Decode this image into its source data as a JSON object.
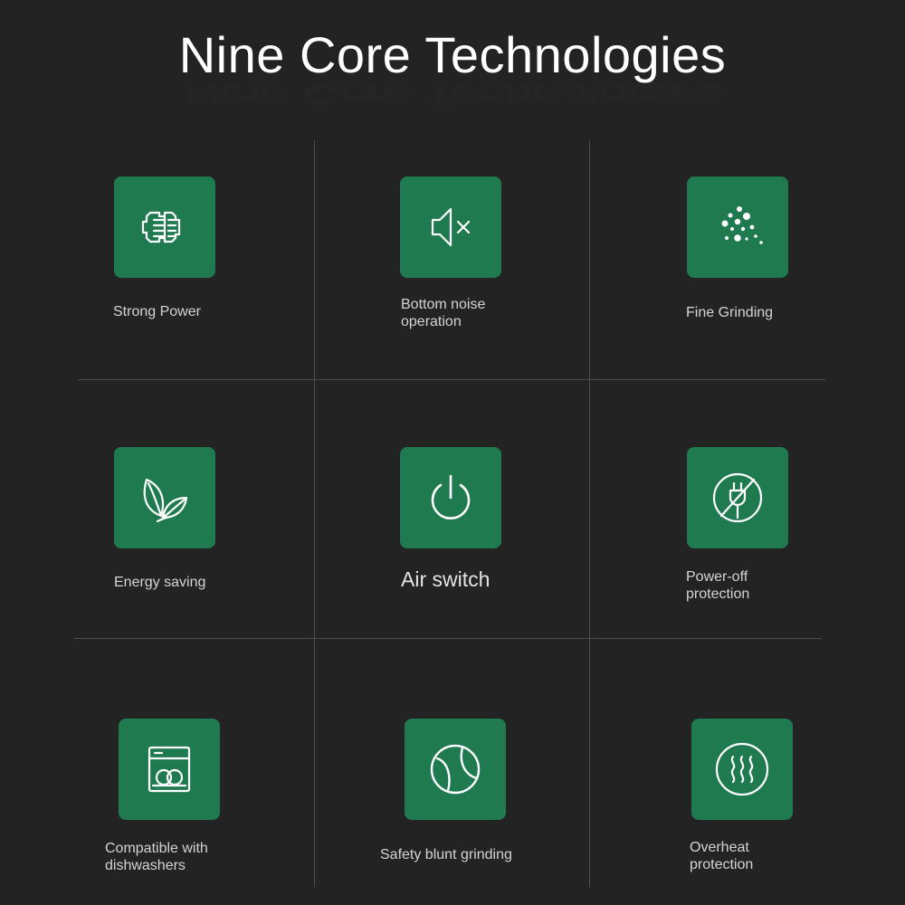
{
  "header": {
    "title": "Nine Core Technologies"
  },
  "features": [
    {
      "icon": "motor-icon",
      "lines": [
        "Strong Power"
      ]
    },
    {
      "icon": "mute-icon",
      "lines": [
        "Bottom noise",
        "operation"
      ]
    },
    {
      "icon": "particles-icon",
      "lines": [
        "Fine Grinding"
      ]
    },
    {
      "icon": "leaf-icon",
      "lines": [
        "Energy saving"
      ]
    },
    {
      "icon": "power-icon",
      "lines": [
        "Air switch"
      ]
    },
    {
      "icon": "no-plug-icon",
      "lines": [
        "Power-off",
        "protection"
      ]
    },
    {
      "icon": "dishwasher-icon",
      "lines": [
        "Compatible with",
        "dishwashers"
      ]
    },
    {
      "icon": "ball-icon",
      "lines": [
        "Safety blunt grinding"
      ]
    },
    {
      "icon": "heat-icon",
      "lines": [
        "Overheat",
        "protection"
      ]
    }
  ],
  "colors": {
    "background": "#232323",
    "icon_tile": "#1f7a4f",
    "icon_stroke": "#ffffff",
    "grid_line": "#4d4d4d"
  }
}
